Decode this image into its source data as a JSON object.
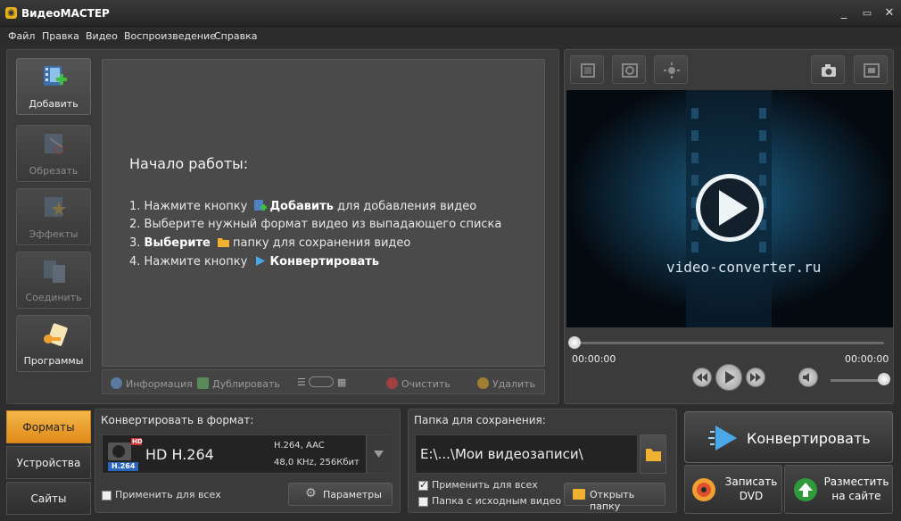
{
  "window": {
    "title": "ВидеоМАСТЕР",
    "minimize": "_",
    "maximize": "▭",
    "close": "✕"
  },
  "menu": [
    "Файл",
    "Правка",
    "Видео",
    "Воспроизведение",
    "Справка"
  ],
  "tools": [
    {
      "label": "Добавить",
      "icon": "add-video-icon"
    },
    {
      "label": "Обрезать",
      "icon": "cut-icon"
    },
    {
      "label": "Эффекты",
      "icon": "effects-icon"
    },
    {
      "label": "Соединить",
      "icon": "join-icon"
    },
    {
      "label": "Программы",
      "icon": "programs-icon"
    }
  ],
  "instructions": {
    "title": "Начало работы:",
    "step1_pre": "1. Нажмите кнопку",
    "step1_bold": "Добавить",
    "step1_post": "для добавления видео",
    "step2": "2. Выберите нужный формат видео из выпадающего списка",
    "step3_pre": "3.",
    "step3_bold": "Выберите",
    "step3_post": "папку для сохранения видео",
    "step4_pre": "4. Нажмите кнопку",
    "step4_bold": "Конвертировать"
  },
  "listbar": {
    "info": "Информация",
    "duplicate": "Дублировать",
    "clear": "Очистить",
    "delete": "Удалить"
  },
  "preview": {
    "watermark": "video-converter.ru",
    "time_current": "00:00:00",
    "time_total": "00:00:00"
  },
  "tabs": {
    "formats": "Форматы",
    "devices": "Устройства",
    "sites": "Сайты"
  },
  "format": {
    "heading": "Конвертировать в формат:",
    "badge_hd": "HD",
    "badge_codec": "H.264",
    "name": "HD H.264",
    "spec1": "H.264, AAC",
    "spec2": "48,0 KHz, 256Кбит",
    "apply_all": "Применить для всех",
    "params_button": "Параметры"
  },
  "save": {
    "heading": "Папка для сохранения:",
    "path": "E:\\...\\Мои видеозаписи\\",
    "apply_all": "Применить для всех",
    "source_folder": "Папка с исходным видео",
    "open_folder": "Открыть папку"
  },
  "actions": {
    "convert": "Конвертировать",
    "dvd": "Записать\nDVD",
    "site": "Разместить\nна сайте"
  },
  "colors": {
    "accent_orange": "#f0a030",
    "convert_blue": "#4aa8e8",
    "green_plus": "#3cbf3c"
  }
}
